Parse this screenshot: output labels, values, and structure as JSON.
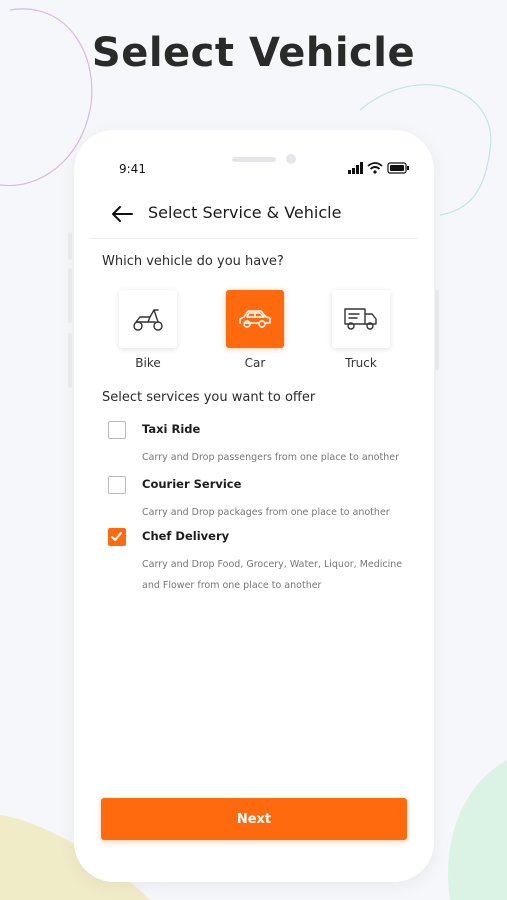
{
  "headline": "Select Vehicle",
  "status_bar": {
    "time": "9:41"
  },
  "header": {
    "title": "Select Service & Vehicle"
  },
  "vehicle_question": "Which vehicle do you have?",
  "vehicles": [
    {
      "label": "Bike",
      "icon": "scooter-icon",
      "selected": false
    },
    {
      "label": "Car",
      "icon": "car-icon",
      "selected": true
    },
    {
      "label": "Truck",
      "icon": "truck-icon",
      "selected": false
    }
  ],
  "services_heading": "Select services you want to offer",
  "services": [
    {
      "title": "Taxi Ride",
      "description": "Carry and Drop passengers from one place to another",
      "checked": false
    },
    {
      "title": "Courier Service",
      "description": "Carry and Drop packages from one place to another",
      "checked": false
    },
    {
      "title": "Chef Delivery",
      "description": "Carry and Drop Food, Grocery, Water, Liquor, Medicine\n and Flower from one place to another",
      "checked": true
    }
  ],
  "next_button": "Next",
  "colors": {
    "accent": "#ff6a0f",
    "background": "#f6f7fb",
    "text": "#222222"
  }
}
